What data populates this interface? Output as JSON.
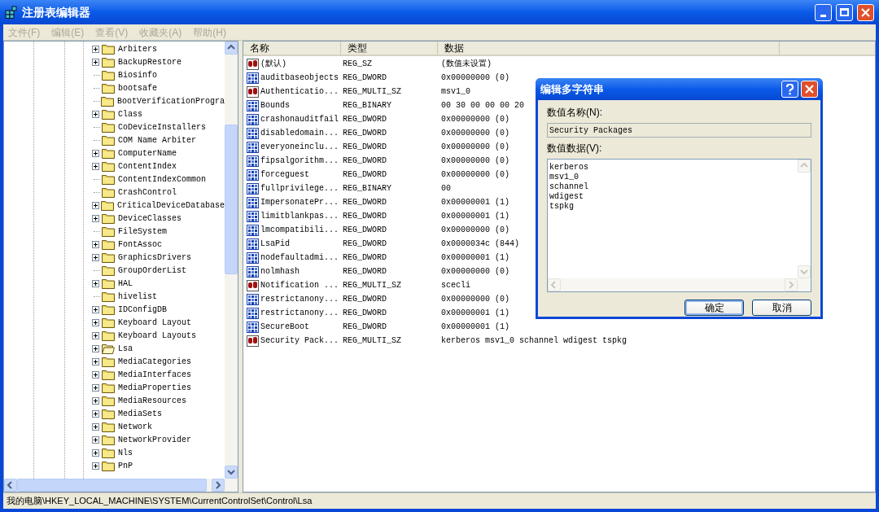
{
  "window": {
    "title": "注册表编辑器"
  },
  "menu": [
    {
      "label": "文件(F)",
      "disabled": true
    },
    {
      "label": "编辑(E)",
      "disabled": true
    },
    {
      "label": "查看(V)",
      "disabled": true
    },
    {
      "label": "收藏夹(A)",
      "disabled": true
    },
    {
      "label": "帮助(H)",
      "disabled": true
    }
  ],
  "tree": {
    "items": [
      {
        "label": "Arbiters",
        "expandable": true,
        "open": false
      },
      {
        "label": "BackupRestore",
        "expandable": true,
        "open": false
      },
      {
        "label": "Biosinfo",
        "expandable": false,
        "open": false
      },
      {
        "label": "bootsafe",
        "expandable": false,
        "open": false
      },
      {
        "label": "BootVerificationProgra",
        "expandable": false,
        "open": false
      },
      {
        "label": "Class",
        "expandable": true,
        "open": false
      },
      {
        "label": "CoDeviceInstallers",
        "expandable": false,
        "open": false
      },
      {
        "label": "COM Name Arbiter",
        "expandable": false,
        "open": false
      },
      {
        "label": "ComputerName",
        "expandable": true,
        "open": false
      },
      {
        "label": "ContentIndex",
        "expandable": true,
        "open": false
      },
      {
        "label": "ContentIndexCommon",
        "expandable": false,
        "open": false
      },
      {
        "label": "CrashControl",
        "expandable": false,
        "open": false
      },
      {
        "label": "CriticalDeviceDatabase",
        "expandable": true,
        "open": false
      },
      {
        "label": "DeviceClasses",
        "expandable": true,
        "open": false
      },
      {
        "label": "FileSystem",
        "expandable": false,
        "open": false
      },
      {
        "label": "FontAssoc",
        "expandable": true,
        "open": false
      },
      {
        "label": "GraphicsDrivers",
        "expandable": true,
        "open": false
      },
      {
        "label": "GroupOrderList",
        "expandable": false,
        "open": false
      },
      {
        "label": "HAL",
        "expandable": true,
        "open": false
      },
      {
        "label": "hivelist",
        "expandable": false,
        "open": false
      },
      {
        "label": "IDConfigDB",
        "expandable": true,
        "open": false
      },
      {
        "label": "Keyboard Layout",
        "expandable": true,
        "open": false
      },
      {
        "label": "Keyboard Layouts",
        "expandable": true,
        "open": false
      },
      {
        "label": "Lsa",
        "expandable": true,
        "open": true
      },
      {
        "label": "MediaCategories",
        "expandable": true,
        "open": false
      },
      {
        "label": "MediaInterfaces",
        "expandable": true,
        "open": false
      },
      {
        "label": "MediaProperties",
        "expandable": true,
        "open": false
      },
      {
        "label": "MediaResources",
        "expandable": true,
        "open": false
      },
      {
        "label": "MediaSets",
        "expandable": true,
        "open": false
      },
      {
        "label": "Network",
        "expandable": true,
        "open": false
      },
      {
        "label": "NetworkProvider",
        "expandable": true,
        "open": false
      },
      {
        "label": "Nls",
        "expandable": true,
        "open": false
      },
      {
        "label": "PnP",
        "expandable": true,
        "open": false
      }
    ]
  },
  "list": {
    "columns": [
      "名称",
      "类型",
      "数据"
    ],
    "rows": [
      {
        "kind": "string",
        "name": "(默认)",
        "type": "REG_SZ",
        "data": "(数值未设置)"
      },
      {
        "kind": "binary",
        "name": "auditbaseobjects",
        "type": "REG_DWORD",
        "data": "0x00000000 (0)"
      },
      {
        "kind": "string",
        "name": "Authenticatio...",
        "type": "REG_MULTI_SZ",
        "data": "msv1_0"
      },
      {
        "kind": "binary",
        "name": "Bounds",
        "type": "REG_BINARY",
        "data": "00 30 00 00 00 20"
      },
      {
        "kind": "binary",
        "name": "crashonauditfail",
        "type": "REG_DWORD",
        "data": "0x00000000 (0)"
      },
      {
        "kind": "binary",
        "name": "disabledomain...",
        "type": "REG_DWORD",
        "data": "0x00000000 (0)"
      },
      {
        "kind": "binary",
        "name": "everyoneinclu...",
        "type": "REG_DWORD",
        "data": "0x00000000 (0)"
      },
      {
        "kind": "binary",
        "name": "fipsalgorithm...",
        "type": "REG_DWORD",
        "data": "0x00000000 (0)"
      },
      {
        "kind": "binary",
        "name": "forceguest",
        "type": "REG_DWORD",
        "data": "0x00000000 (0)"
      },
      {
        "kind": "binary",
        "name": "fullprivilege...",
        "type": "REG_BINARY",
        "data": "00"
      },
      {
        "kind": "binary",
        "name": "ImpersonatePr...",
        "type": "REG_DWORD",
        "data": "0x00000001 (1)"
      },
      {
        "kind": "binary",
        "name": "limitblankpas...",
        "type": "REG_DWORD",
        "data": "0x00000001 (1)"
      },
      {
        "kind": "binary",
        "name": "lmcompatibili...",
        "type": "REG_DWORD",
        "data": "0x00000000 (0)"
      },
      {
        "kind": "binary",
        "name": "LsaPid",
        "type": "REG_DWORD",
        "data": "0x0000034c (844)"
      },
      {
        "kind": "binary",
        "name": "nodefaultadmi...",
        "type": "REG_DWORD",
        "data": "0x00000001 (1)"
      },
      {
        "kind": "binary",
        "name": "nolmhash",
        "type": "REG_DWORD",
        "data": "0x00000000 (0)"
      },
      {
        "kind": "string",
        "name": "Notification ...",
        "type": "REG_MULTI_SZ",
        "data": "scecli"
      },
      {
        "kind": "binary",
        "name": "restrictanony...",
        "type": "REG_DWORD",
        "data": "0x00000000 (0)"
      },
      {
        "kind": "binary",
        "name": "restrictanony...",
        "type": "REG_DWORD",
        "data": "0x00000001 (1)"
      },
      {
        "kind": "binary",
        "name": "SecureBoot",
        "type": "REG_DWORD",
        "data": "0x00000001 (1)"
      },
      {
        "kind": "string",
        "name": "Security Pack...",
        "type": "REG_MULTI_SZ",
        "data": "kerberos msv1_0 schannel wdigest tspkg"
      }
    ]
  },
  "status_bar": {
    "path": "我的电脑\\HKEY_LOCAL_MACHINE\\SYSTEM\\CurrentControlSet\\Control\\Lsa"
  },
  "dialog": {
    "title": "编辑多字符串",
    "name_label": "数值名称(N):",
    "name_value": "Security Packages",
    "data_label": "数值数据(V):",
    "data_lines": [
      "kerberos",
      "msv1_0",
      "schannel",
      "wdigest",
      "tspkg"
    ],
    "buttons": [
      {
        "label": "确定",
        "default": true
      },
      {
        "label": "取消",
        "default": false
      }
    ]
  }
}
